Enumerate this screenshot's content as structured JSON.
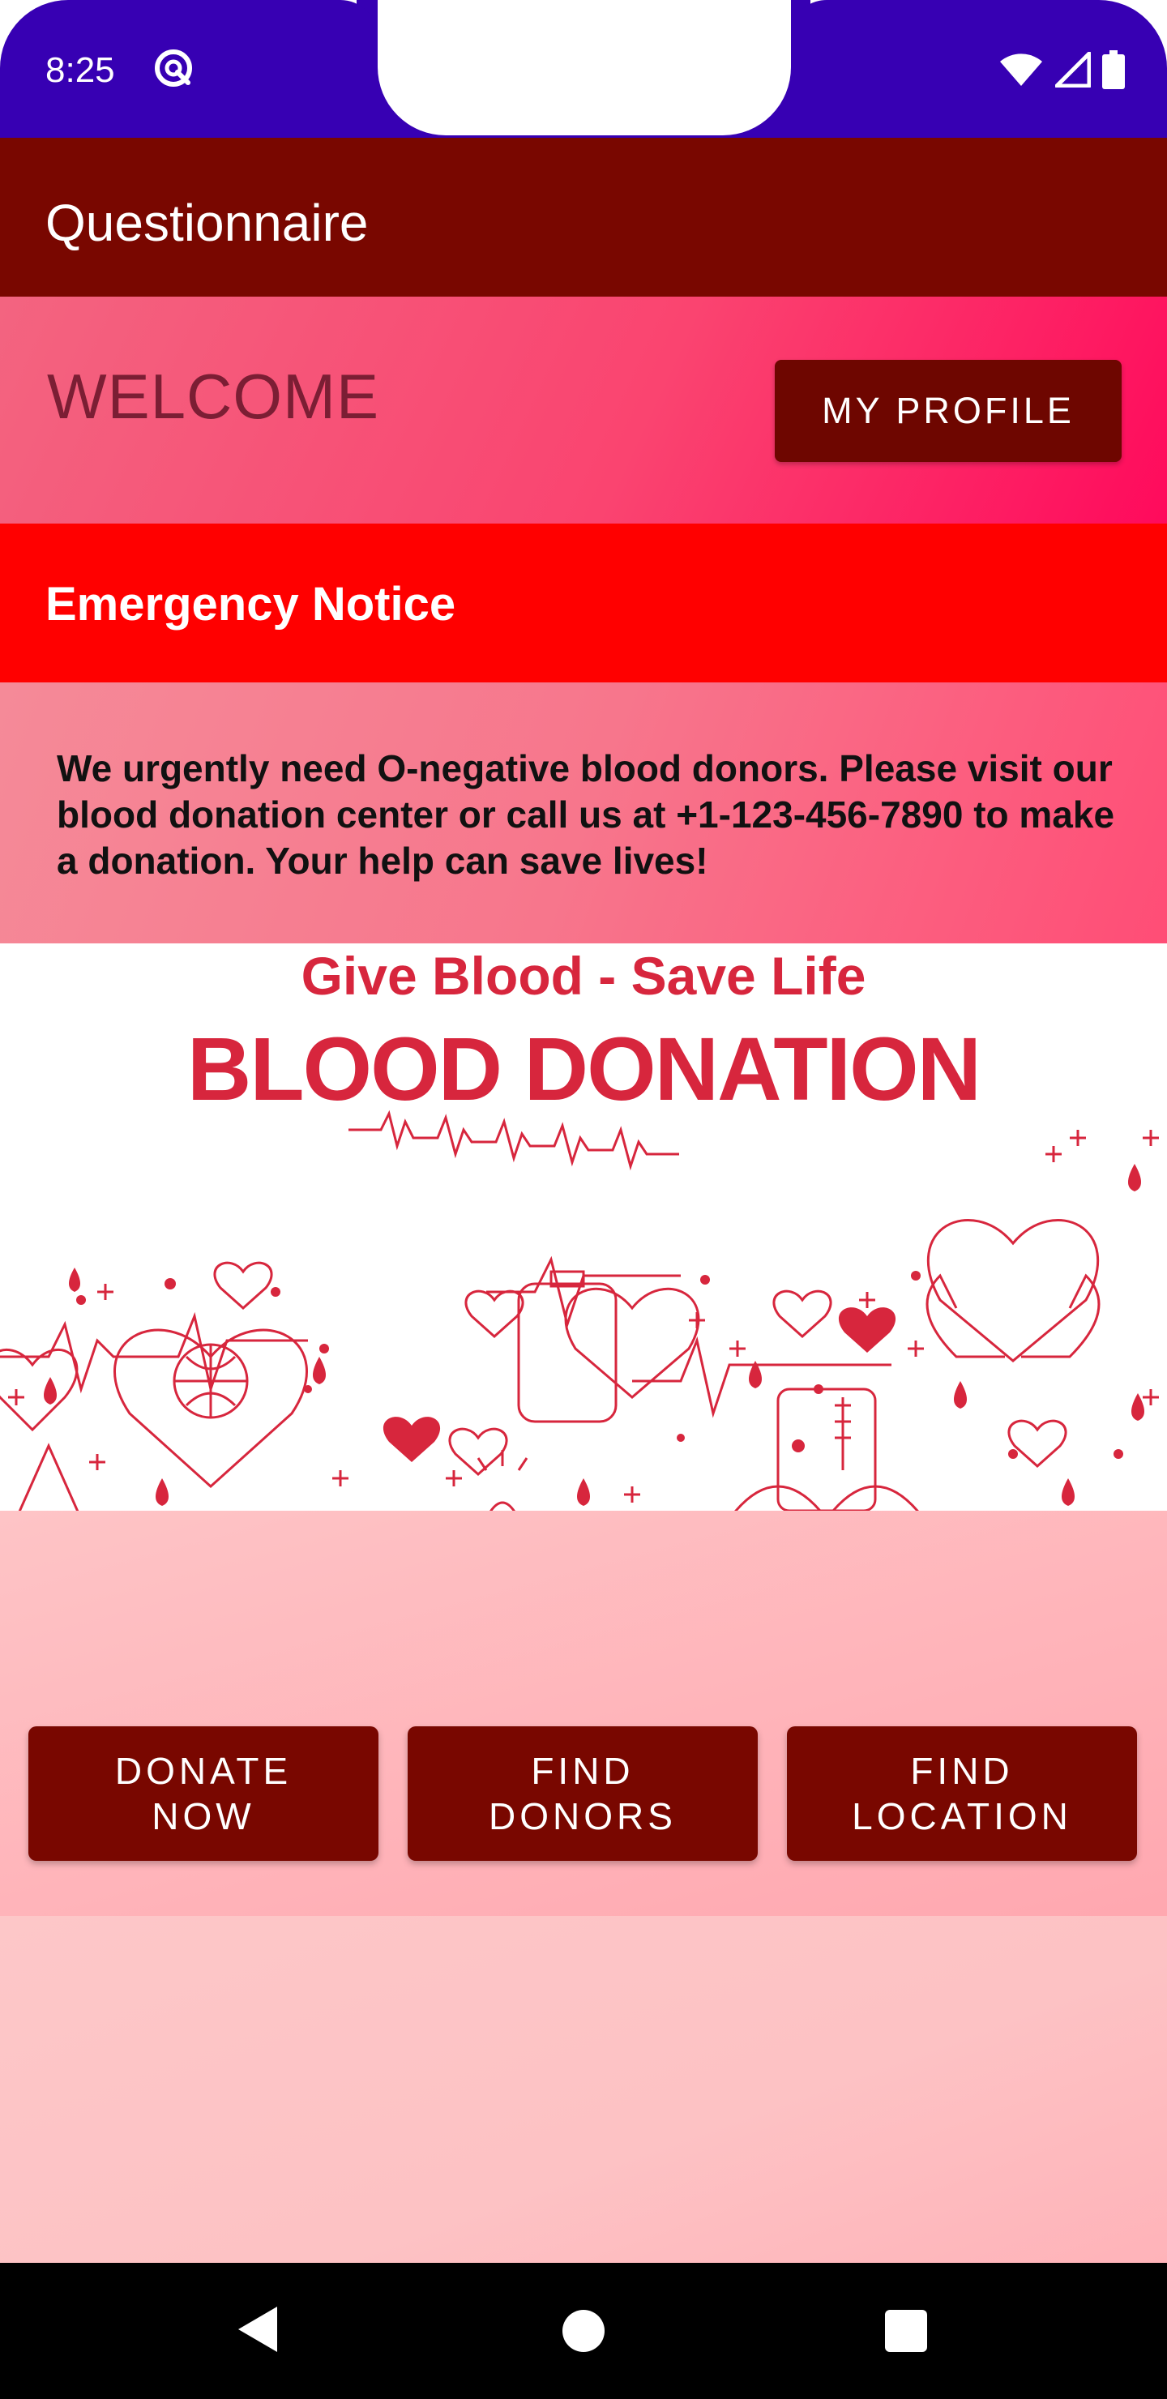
{
  "status_bar": {
    "time": "8:25",
    "icons": [
      "app-notification-icon",
      "wifi-icon",
      "signal-icon",
      "battery-icon"
    ]
  },
  "app_bar": {
    "title": "Questionnaire"
  },
  "welcome": {
    "text": "WELCOME",
    "profile_button": "MY PROFILE"
  },
  "emergency": {
    "title": "Emergency Notice",
    "message": "We urgently need O-negative blood donors. Please visit our blood donation center or call us at +1-123-456-7890 to make a donation. Your help can save lives!"
  },
  "banner": {
    "subtitle": "Give Blood - Save Life",
    "title": "BLOOD DONATION"
  },
  "actions": {
    "donate": "DONATE\nNOW",
    "find_donors": "FIND\nDONORS",
    "find_location": "FIND\nLOCATION"
  },
  "nav": {
    "icons": [
      "back-icon",
      "home-icon",
      "recents-icon"
    ]
  },
  "colors": {
    "status_bar": "#3700b3",
    "app_bar": "#790700",
    "emergency": "#ff0000",
    "button": "#790700",
    "accent_red": "#d7263d"
  }
}
